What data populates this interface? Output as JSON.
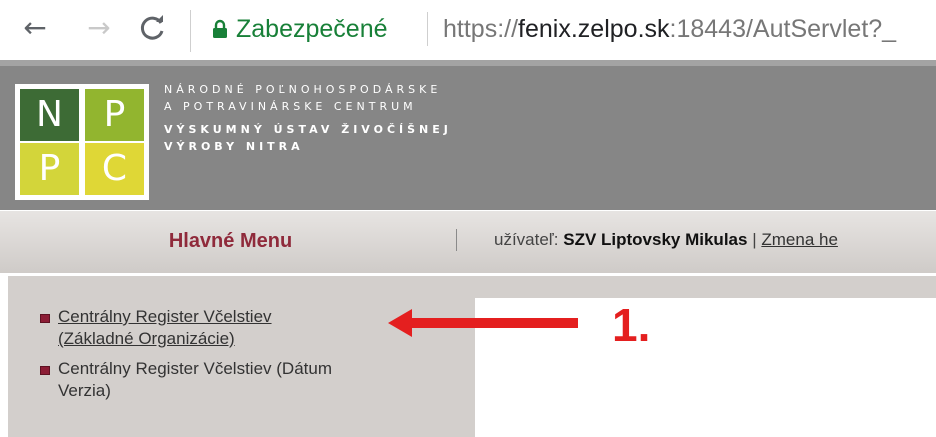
{
  "browser": {
    "back_icon": "←",
    "forward_icon": "→",
    "reload_icon": "C",
    "secure_label": "Zabezpečené",
    "url_scheme": "https://",
    "url_host": "fenix.zelpo.sk",
    "url_rest": ":18443/AutServlet?_",
    "colors": {
      "secure": "#188038"
    }
  },
  "header": {
    "logo_letters": [
      "N",
      "P",
      "P",
      "C"
    ],
    "institution_lines": [
      "NÁRODNÉ POĽNOHOSPODÁRSKE",
      "A POTRAVINÁRSKE CENTRUM",
      "VÝSKUMNÝ ÚSTAV ŽIVOČÍŠNEJ",
      "VÝROBY NITRA"
    ],
    "colors": {
      "header_bg": "#868686",
      "logo_dark_green": "#3d6b35",
      "logo_green": "#92b52f",
      "logo_yellow": "#d3d53a"
    }
  },
  "menu_bar": {
    "title": "Hlavné Menu",
    "user_prefix": "užívateľ:",
    "user_name": "SZV Liptovsky Mikulas",
    "separator": "|",
    "change_link": "Zmena he",
    "colors": {
      "title": "#8f2a3b"
    }
  },
  "sidebar": {
    "items": [
      {
        "label_line1": "Centrálny Register Včelstiev",
        "label_line2": "(Základné Organizácie)"
      },
      {
        "label_line1": "Centrálny Register Včelstiev (Dátum",
        "label_line2": "Verzia)"
      }
    ]
  },
  "annotation": {
    "step_label": "1.",
    "color": "#e41f1f"
  }
}
